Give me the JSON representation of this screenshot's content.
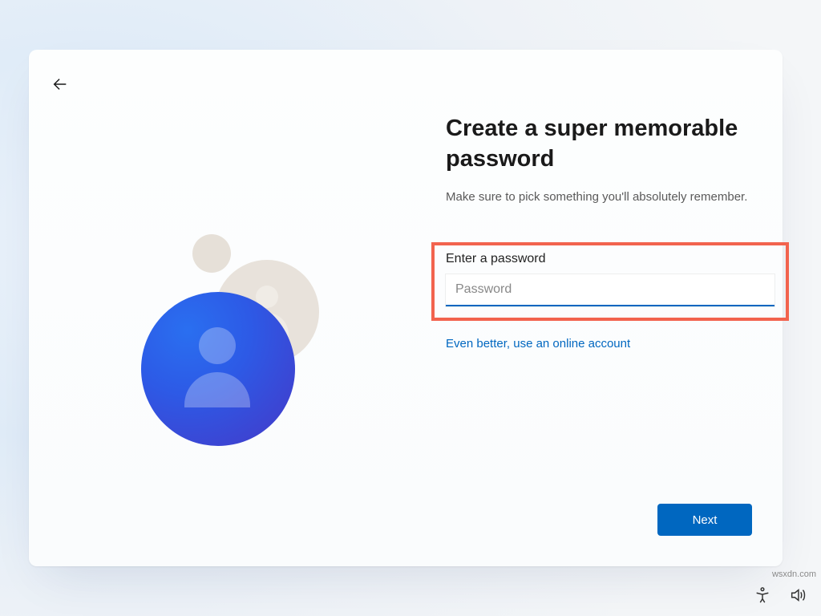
{
  "header": {
    "back_label": "Back"
  },
  "illustration": {
    "name": "user-profile-glyph"
  },
  "content": {
    "title": "Create a super memorable password",
    "subtitle": "Make sure to pick something you'll absolutely remember.",
    "field_label": "Enter a password",
    "password_placeholder": "Password",
    "password_value": "",
    "online_link": "Even better, use an online account"
  },
  "actions": {
    "next": "Next"
  },
  "tray": {
    "accessibility": "Accessibility",
    "volume": "Volume"
  },
  "watermark": "wsxdn.com",
  "colors": {
    "accent": "#0067c0",
    "highlight": "#f2634e"
  }
}
